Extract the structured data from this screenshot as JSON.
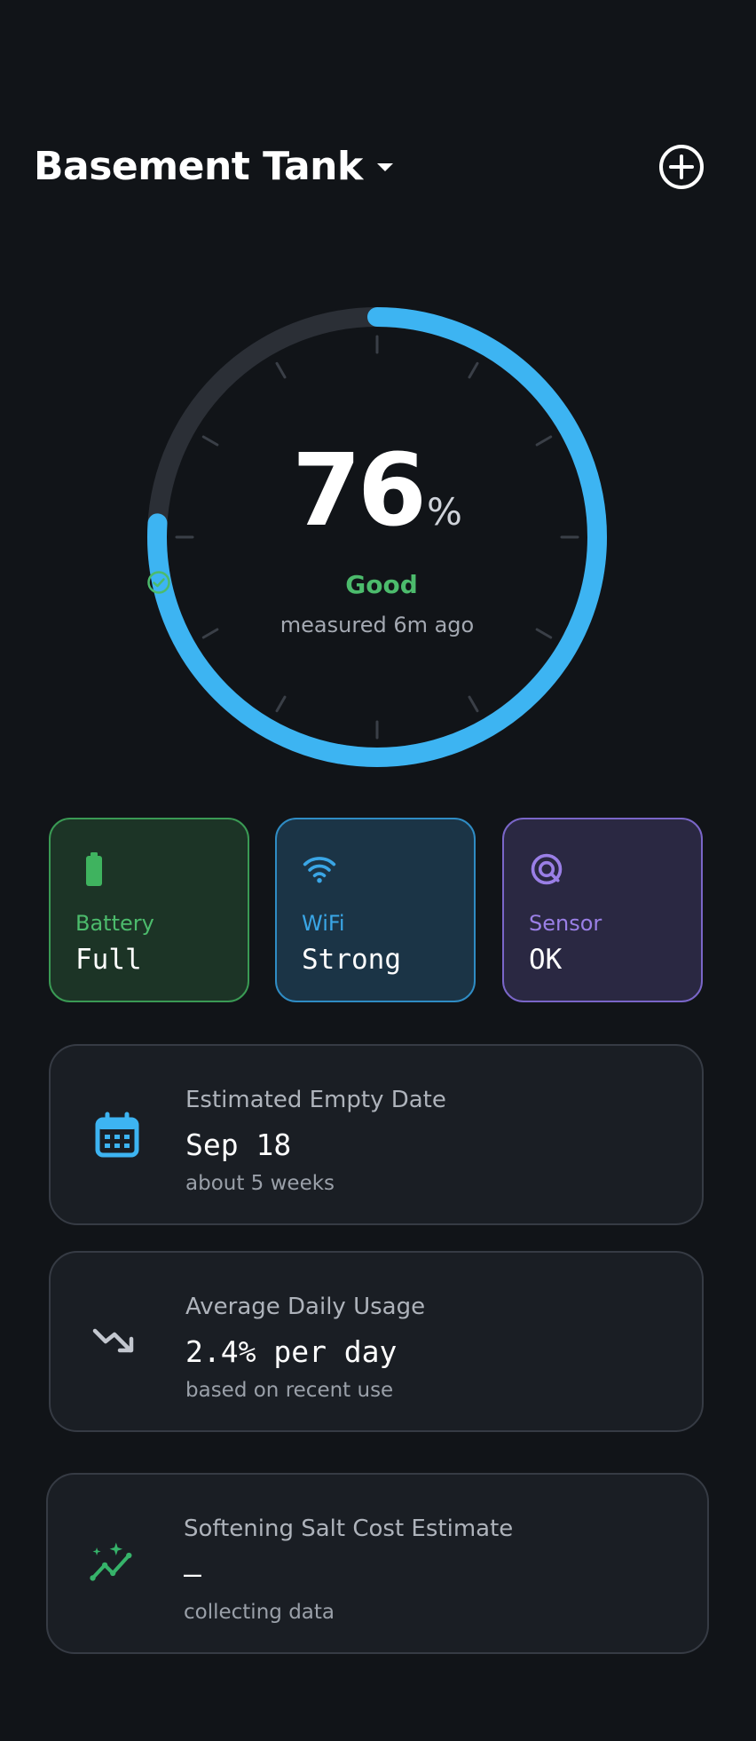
{
  "header": {
    "title": "Basement Tank"
  },
  "gauge": {
    "level_percent": 76,
    "value_text": "76",
    "unit": "%",
    "status": "Good",
    "measured": "measured 6m ago",
    "color_fill": "#3db4f2",
    "color_track": "#2b2f36"
  },
  "tiles": [
    {
      "label": "Battery",
      "value": "Full",
      "icon": "battery-icon",
      "color": "#4cbb6c"
    },
    {
      "label": "WiFi",
      "value": "Strong",
      "icon": "wifi-icon",
      "color": "#3aa6e6"
    },
    {
      "label": "Sensor",
      "value": "OK",
      "icon": "sensor-icon",
      "color": "#9a7fe6"
    }
  ],
  "cards": [
    {
      "label": "Estimated Empty Date",
      "value": "Sep 18",
      "sub": "about 5 weeks",
      "icon": "calendar-icon"
    },
    {
      "label": "Average Daily Usage",
      "value": "2.4% per day",
      "sub": "based on recent use",
      "icon": "trending-down-icon"
    },
    {
      "label": "Softening Salt Cost Estimate",
      "value": "—",
      "sub": "collecting data",
      "icon": "sparkle-chart-icon"
    }
  ]
}
